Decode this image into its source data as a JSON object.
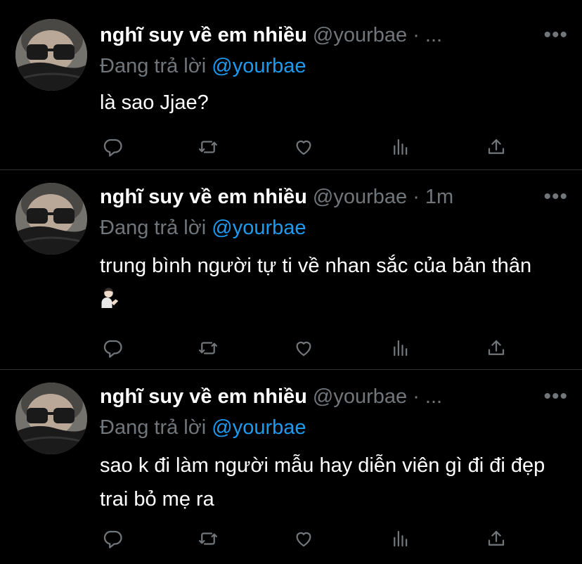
{
  "tweets": [
    {
      "name": "nghĩ suy về em nhiều",
      "meta": "@yourbae · ...",
      "reply_prefix": "Đang trả lời",
      "reply_to": "@yourbae",
      "text": "là sao Jjae?"
    },
    {
      "name": "nghĩ suy về em nhiều",
      "meta": "@yourbae · 1m",
      "reply_prefix": "Đang trả lời",
      "reply_to": "@yourbae",
      "text": "trung bình người tự ti về nhan sắc của bản thân"
    },
    {
      "name": "nghĩ suy về em nhiều",
      "meta": "@yourbae · ...",
      "reply_prefix": "Đang trả lời",
      "reply_to": "@yourbae",
      "text": "sao k đi làm người mẫu hay diễn viên gì đi đi đẹp trai bỏ mẹ ra"
    }
  ],
  "icons": {
    "more": "•••",
    "reply": "reply-icon",
    "retweet": "retweet-icon",
    "like": "heart-icon",
    "views": "views-icon",
    "share": "share-icon",
    "emoji": "person-tipping-hand-emoji"
  },
  "colors": {
    "background": "#000000",
    "text": "#e7e9ea",
    "muted": "#71767b",
    "link": "#1d9bf0",
    "divider": "#2f3336"
  }
}
